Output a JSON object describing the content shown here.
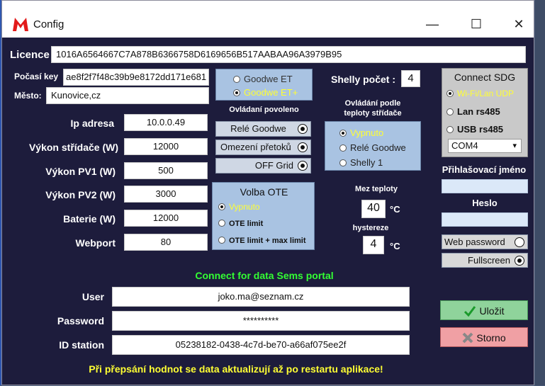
{
  "window": {
    "title": "Config",
    "minimize": "—",
    "maximize": "☐",
    "close": "✕"
  },
  "licence": {
    "label": "Licence",
    "value": "1016A6564667C7A878B6366758D6169656B517AABAA96A3979B95"
  },
  "weather": {
    "key_label": "Počasí key",
    "key_value": "ae8f2f7f48c39b9e8172dd171e681",
    "city_label": "Město:",
    "city_value": "Kunovice,cz"
  },
  "inverter_type": {
    "options": [
      "Goodwe ET",
      "Goodwe ET+"
    ],
    "selected": "Goodwe ET+"
  },
  "control_enabled": {
    "title": "Ovládaní  povoleno",
    "items": [
      {
        "label": "Relé Goodwe",
        "on": true
      },
      {
        "label": "Omezení přetoků",
        "on": true
      },
      {
        "label": "OFF Grid",
        "on": true
      }
    ]
  },
  "fields": {
    "ip": {
      "label": "Ip adresa",
      "value": "10.0.0.49"
    },
    "inverter_power": {
      "label": "Výkon střídače (W)",
      "value": "12000"
    },
    "pv1": {
      "label": "Výkon PV1 (W)",
      "value": "500"
    },
    "pv2": {
      "label": "Výkon PV2 (W)",
      "value": "3000"
    },
    "battery": {
      "label": "Baterie (W)",
      "value": "12000"
    },
    "webport": {
      "label": "Webport",
      "value": "80"
    }
  },
  "ote": {
    "title": "Volba OTE",
    "options": [
      "Vypnuto",
      "OTE limit",
      "OTE limit + max limit"
    ],
    "selected": "Vypnuto"
  },
  "shelly": {
    "count_label": "Shelly počet :",
    "count_value": "4",
    "control_title_1": "Ovládání podle",
    "control_title_2": "teploty střídače",
    "options": [
      "Vypnuto",
      "Relé Goodwe",
      "Shelly 1"
    ],
    "selected": "Vypnuto",
    "temp_limit_label": "Mez teploty",
    "temp_limit_value": "40",
    "temp_unit": "°C",
    "hysteresis_label": "hystereze",
    "hysteresis_value": "4",
    "hysteresis_unit": "°C"
  },
  "connect_sdg": {
    "title": "Connect SDG",
    "options": [
      "Wi-Fi/Lan UDP",
      "Lan rs485",
      "USB rs485"
    ],
    "selected": "Wi-Fi/Lan UDP",
    "port": "COM4"
  },
  "login": {
    "username_label": "Přihlašovací jméno",
    "username_value": "",
    "password_label": "Heslo",
    "password_value": ""
  },
  "toggles": {
    "web_password": "Web password",
    "fullscreen": "Fullscreen"
  },
  "sems": {
    "heading": "Connect for data Sems portal",
    "user_label": "User",
    "user_value": "joko.ma@seznam.cz",
    "password_label": "Password",
    "password_value": "**********",
    "station_label": "ID station",
    "station_value": "05238182-0438-4c7d-be70-a66af075ee2f"
  },
  "buttons": {
    "save": "Uložit",
    "cancel": "Storno"
  },
  "footer_note": "Při přepsání hodnot se data aktualizují až po restartu aplikace!",
  "colors": {
    "window_bg": "#1d1c3c",
    "accent_green": "#33ff33",
    "accent_yellow": "#ffff33",
    "panel_blue": "#a9c3e2"
  }
}
